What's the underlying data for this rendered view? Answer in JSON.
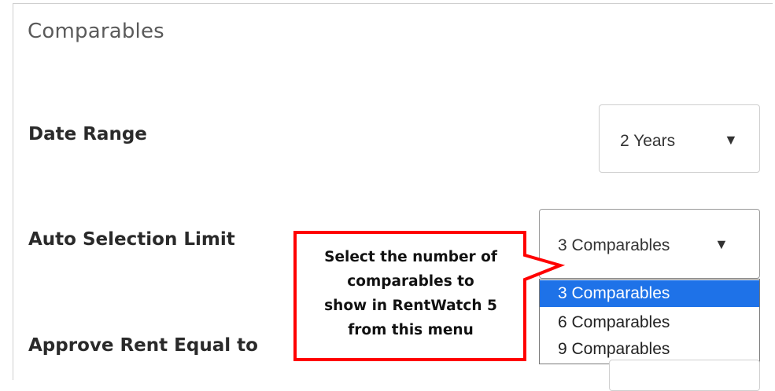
{
  "panel": {
    "title": "Comparables"
  },
  "date_range": {
    "label": "Date Range",
    "selected": "2 Years",
    "arrow": "▼"
  },
  "auto_selection": {
    "label": "Auto Selection Limit",
    "selected": "3 Comparables",
    "arrow": "▼",
    "options": [
      "3 Comparables",
      "6 Comparables",
      "9 Comparables"
    ],
    "highlighted_index": 0
  },
  "approve_rent": {
    "label": "Approve Rent Equal to"
  },
  "callout": {
    "lines": [
      "Select the number of",
      "comparables to",
      "show in RentWatch 5",
      "from this menu"
    ],
    "border_color": "#ff0000"
  },
  "colors": {
    "highlight": "#1e72e8",
    "title": "#5a5a5a"
  }
}
